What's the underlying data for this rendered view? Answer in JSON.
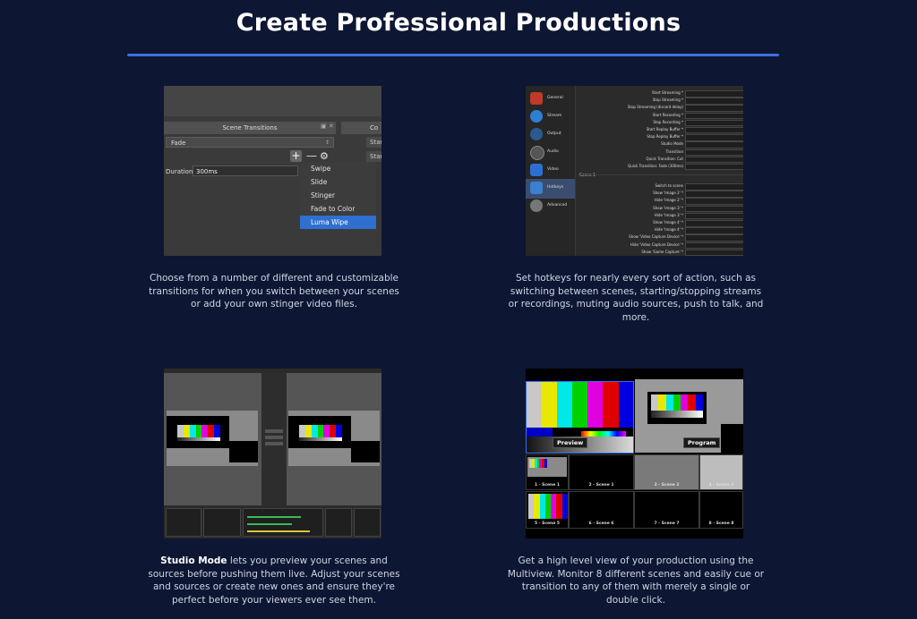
{
  "page": {
    "title": "Create Professional Productions"
  },
  "features": [
    {
      "caption": "Choose from a number of different and customizable transitions for when you switch between your scenes or add your own stinger video files."
    },
    {
      "caption": "Set hotkeys for nearly every sort of action, such as switching between scenes, starting/stopping streams or recordings, muting audio sources, push to talk, and more."
    },
    {
      "caption_bold": "Studio Mode",
      "caption": " lets you preview your scenes and sources before pushing them live. Adjust your scenes and sources or create new ones and ensure they're perfect before your viewers ever see them."
    },
    {
      "caption": "Get a high level view of your production using the Multiview. Monitor 8 different scenes and easily cue or transition to any of them with merely a single or double click."
    }
  ],
  "scene_transitions": {
    "dock_title": "Scene Transitions",
    "dock_buttons": "▣ ✕",
    "second_dock_title": "Co",
    "right_button": "Star",
    "selected_transition": "Fade",
    "duration_label": "Duration",
    "duration_value": "300ms",
    "menu": [
      "Swipe",
      "Slide",
      "Stinger",
      "Fade to Color",
      "Luma Wipe"
    ],
    "menu_selected": "Luma Wipe"
  },
  "hotkeys": {
    "sidebar": [
      {
        "label": "General",
        "icon": "general-icon",
        "color": "#c0392b"
      },
      {
        "label": "Stream",
        "icon": "stream-icon",
        "color": "#2d7fd3"
      },
      {
        "label": "Output",
        "icon": "output-icon",
        "color": "#2a5a8f"
      },
      {
        "label": "Audio",
        "icon": "audio-icon",
        "color": "#555555"
      },
      {
        "label": "Video",
        "icon": "video-icon",
        "color": "#2d6fd0"
      },
      {
        "label": "Hotkeys",
        "icon": "hotkeys-icon",
        "color": "#3b7fcf"
      },
      {
        "label": "Advanced",
        "icon": "advanced-icon",
        "color": "#888888"
      }
    ],
    "active": "Hotkeys",
    "rows": [
      "Start Streaming *",
      "Stop Streaming *",
      "Stop Streaming (discard delay)",
      "Start Recording *",
      "Stop Recording *",
      "Start Replay Buffer *",
      "Stop Replay Buffer *",
      "Studio Mode",
      "Transition",
      "Quick Transition: Cut",
      "Quick Transition: Fade (300ms)"
    ],
    "section": "Scene 1",
    "scene_rows": [
      "Switch to scene",
      "Show 'Image 2' *",
      "Hide 'Image 2' *",
      "Show 'Image 3' *",
      "Hide 'Image 3' *",
      "Show 'Image 4' *",
      "Hide 'Image 4' *",
      "Show 'Video Capture Device' *",
      "Hide 'Video Capture Device' *",
      "Show 'Game Capture' *"
    ]
  },
  "multiview": {
    "preview_label": "Preview",
    "program_label": "Program",
    "scenes": [
      "1 - Scene 1",
      "2 - Scene 1",
      "3 - Scene 2",
      "4 - Scene 3",
      "5 - Scene 5",
      "6 - Scene 6",
      "7 - Scene 7",
      "8 - Scene 8"
    ]
  },
  "colors": {
    "background": "#0d1633",
    "accent": "#3b6fe0",
    "selection": "#2e6fd0",
    "color_bars": [
      "#c8c8c8",
      "#e8e800",
      "#00e8e8",
      "#00d000",
      "#e000e0",
      "#e00000",
      "#0000e0"
    ]
  }
}
